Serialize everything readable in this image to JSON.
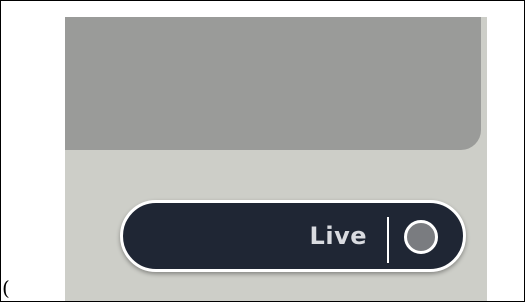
{
  "stray_text": "(",
  "display": {
    "color": "#9a9b99"
  },
  "panel": {
    "color": "#cdcec8"
  },
  "live_button": {
    "label": "Live",
    "background": "#1f2634",
    "indicator_icon": "status-led-icon",
    "indicator_color": "#7a7c80"
  }
}
